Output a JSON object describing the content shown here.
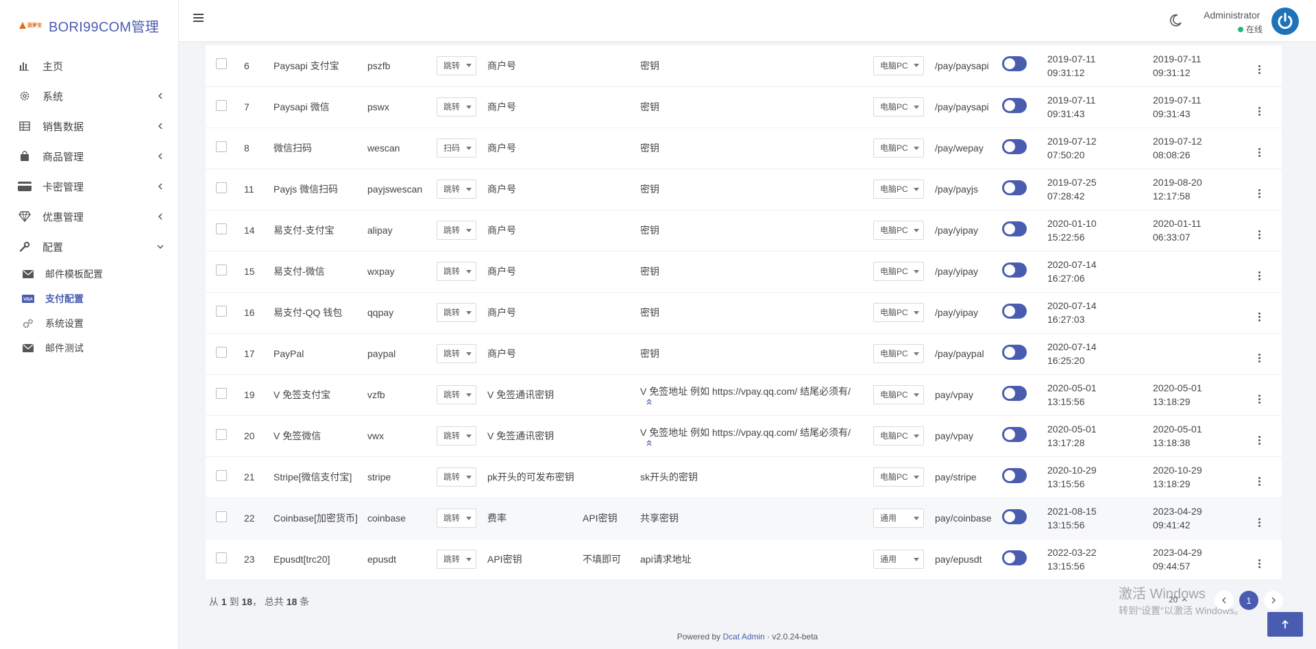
{
  "brand": {
    "logo_text": "菠萝宝",
    "name": "BORI99COM管理"
  },
  "sidebar": {
    "items": [
      {
        "label": "主页",
        "icon": "bar-chart-icon"
      },
      {
        "label": "系统",
        "icon": "gear-icon"
      },
      {
        "label": "销售数据",
        "icon": "table-icon"
      },
      {
        "label": "商品管理",
        "icon": "shopping-bag-icon"
      },
      {
        "label": "卡密管理",
        "icon": "credit-card-icon"
      },
      {
        "label": "优惠管理",
        "icon": "diamond-icon"
      },
      {
        "label": "配置",
        "icon": "wrench-icon"
      }
    ],
    "sub_items": [
      {
        "label": "邮件模板配置",
        "icon": "envelope-icon"
      },
      {
        "label": "支付配置",
        "icon": "visa-card-icon",
        "active": true
      },
      {
        "label": "系统设置",
        "icon": "cogs-icon"
      },
      {
        "label": "邮件测试",
        "icon": "envelope-icon"
      }
    ]
  },
  "topbar": {
    "user_name": "Administrator",
    "user_status": "在线",
    "status_color": "#21b978"
  },
  "table": {
    "rows": [
      {
        "id": "6",
        "name": "Paysapi 支付宝",
        "code": "pszfb",
        "type": "跳转",
        "merchant": "商户号",
        "key2": "",
        "secret": "密钥",
        "device": "电脑PC",
        "route": "/pay/paysapi",
        "enabled": true,
        "created": [
          "2019-07-11",
          "09:31:12"
        ],
        "updated": [
          "2019-07-11",
          "09:31:12"
        ]
      },
      {
        "id": "7",
        "name": "Paysapi 微信",
        "code": "pswx",
        "type": "跳转",
        "merchant": "商户号",
        "key2": "",
        "secret": "密钥",
        "device": "电脑PC",
        "route": "/pay/paysapi",
        "enabled": true,
        "created": [
          "2019-07-11",
          "09:31:43"
        ],
        "updated": [
          "2019-07-11",
          "09:31:43"
        ]
      },
      {
        "id": "8",
        "name": "微信扫码",
        "code": "wescan",
        "type": "扫码",
        "merchant": "商户号",
        "key2": "",
        "secret": "密钥",
        "device": "电脑PC",
        "route": "/pay/wepay",
        "enabled": true,
        "created": [
          "2019-07-12",
          "07:50:20"
        ],
        "updated": [
          "2019-07-12",
          "08:08:26"
        ]
      },
      {
        "id": "11",
        "name": "Payjs 微信扫码",
        "code": "payjswescan",
        "type": "跳转",
        "merchant": "商户号",
        "key2": "",
        "secret": "密钥",
        "device": "电脑PC",
        "route": "/pay/payjs",
        "enabled": true,
        "created": [
          "2019-07-25",
          "07:28:42"
        ],
        "updated": [
          "2019-08-20",
          "12:17:58"
        ]
      },
      {
        "id": "14",
        "name": "易支付-支付宝",
        "code": "alipay",
        "type": "跳转",
        "merchant": "商户号",
        "key2": "",
        "secret": "密钥",
        "device": "电脑PC",
        "route": "/pay/yipay",
        "enabled": true,
        "created": [
          "2020-01-10",
          "15:22:56"
        ],
        "updated": [
          "2020-01-11",
          "06:33:07"
        ]
      },
      {
        "id": "15",
        "name": "易支付-微信",
        "code": "wxpay",
        "type": "跳转",
        "merchant": "商户号",
        "key2": "",
        "secret": "密钥",
        "device": "电脑PC",
        "route": "/pay/yipay",
        "enabled": true,
        "created": [
          "2020-07-14",
          "16:27:06"
        ],
        "updated": [
          "",
          ""
        ]
      },
      {
        "id": "16",
        "name": "易支付-QQ 钱包",
        "code": "qqpay",
        "type": "跳转",
        "merchant": "商户号",
        "key2": "",
        "secret": "密钥",
        "device": "电脑PC",
        "route": "/pay/yipay",
        "enabled": true,
        "created": [
          "2020-07-14",
          "16:27:03"
        ],
        "updated": [
          "",
          ""
        ]
      },
      {
        "id": "17",
        "name": "PayPal",
        "code": "paypal",
        "type": "跳转",
        "merchant": "商户号",
        "key2": "",
        "secret": "密钥",
        "device": "电脑PC",
        "route": "/pay/paypal",
        "enabled": true,
        "created": [
          "2020-07-14",
          "16:25:20"
        ],
        "updated": [
          "",
          ""
        ]
      },
      {
        "id": "19",
        "name": "V 免签支付宝",
        "code": "vzfb",
        "type": "跳转",
        "merchant": "V 免签通讯密钥",
        "key2": "",
        "secret": "V 免签地址 例如 https://vpay.qq.com/ 结尾必须有/",
        "device": "电脑PC",
        "route": "pay/vpay",
        "enabled": true,
        "created": [
          "2020-05-01",
          "13:15:56"
        ],
        "updated": [
          "2020-05-01",
          "13:18:29"
        ],
        "expandable": true
      },
      {
        "id": "20",
        "name": "V 免签微信",
        "code": "vwx",
        "type": "跳转",
        "merchant": "V 免签通讯密钥",
        "key2": "",
        "secret": "V 免签地址 例如 https://vpay.qq.com/ 结尾必须有/",
        "device": "电脑PC",
        "route": "pay/vpay",
        "enabled": true,
        "created": [
          "2020-05-01",
          "13:17:28"
        ],
        "updated": [
          "2020-05-01",
          "13:18:38"
        ],
        "expandable": true
      },
      {
        "id": "21",
        "name": "Stripe[微信支付宝]",
        "code": "stripe",
        "type": "跳转",
        "merchant": "pk开头的可发布密钥",
        "key2": "",
        "secret": "sk开头的密钥",
        "device": "电脑PC",
        "route": "pay/stripe",
        "enabled": true,
        "created": [
          "2020-10-29",
          "13:15:56"
        ],
        "updated": [
          "2020-10-29",
          "13:18:29"
        ]
      },
      {
        "id": "22",
        "name": "Coinbase[加密货币]",
        "code": "coinbase",
        "type": "跳转",
        "merchant": "费率",
        "key2": "API密钥",
        "secret": "共享密钥",
        "device": "通用",
        "route": "pay/coinbase",
        "enabled": true,
        "created": [
          "2021-08-15",
          "13:15:56"
        ],
        "updated": [
          "2023-04-29",
          "09:41:42"
        ],
        "highlight": true
      },
      {
        "id": "23",
        "name": "Epusdt[trc20]",
        "code": "epusdt",
        "type": "跳转",
        "merchant": "API密钥",
        "key2": "不填即可",
        "secret": "api请求地址",
        "device": "通用",
        "route": "pay/epusdt",
        "enabled": true,
        "created": [
          "2022-03-22",
          "13:15:56"
        ],
        "updated": [
          "2023-04-29",
          "09:44:57"
        ]
      }
    ]
  },
  "footer": {
    "summary_prefix": "从",
    "from": "1",
    "to_word": "到",
    "to": "18",
    "total_prefix": "， 总共",
    "total": "18",
    "total_suffix": "条",
    "per_page": "20",
    "current_page": "1",
    "powered_prefix": "Powered by",
    "powered_link": "Dcat Admin",
    "powered_sep": "·",
    "version": "v2.0.24-beta"
  },
  "watermark": {
    "line1": "激活 Windows",
    "line2": "转到\"设置\"以激活 Windows。"
  },
  "accent_color": "#4a5cb0"
}
